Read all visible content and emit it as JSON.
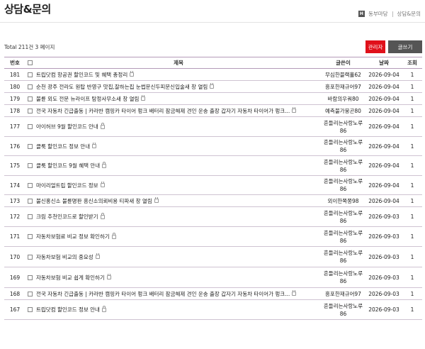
{
  "page": {
    "title": "상담&문의",
    "breadcrumb": {
      "home_glyph": "H",
      "section": "동부마당",
      "current": "상담&문의"
    }
  },
  "toolbar": {
    "total": "Total 211건 3 페이지",
    "admin_label": "관리자",
    "write_label": "글쓰기"
  },
  "table": {
    "headers": {
      "num": "번호",
      "subject": "제목",
      "writer": "글쓴이",
      "date": "날짜",
      "views": "조회"
    },
    "rows": [
      {
        "num": "181",
        "subject": "트립닷컴 항공권 할인코드 및 혜택 총정리",
        "writer": "무심한블랙홀62",
        "date": "2026-09-04",
        "views": "1",
        "h": 17
      },
      {
        "num": "180",
        "subject": "순천 광주 전라도 원탑 반영구 맛집,잘하는집 눈썹문신두피문신입술새 창 열림",
        "writer": "흥포한재규어97",
        "date": "2026-09-04",
        "views": "1",
        "h": 17
      },
      {
        "num": "179",
        "subject": "불륜 외도 전문 뉴라이프 탐정사무소새 창 열림",
        "writer": "바람의우쿼80",
        "date": "2026-09-04",
        "views": "1",
        "h": 17
      },
      {
        "num": "178",
        "subject": "전국 자동차 긴급출동 | 카라반 캠핑카 타이어 펑크 배터리 잠금해제 견인 운송 출장 갑자기 자동차 타이어가 펑크...",
        "writer": "예측불가뭉곤80",
        "date": "2026-09-04",
        "views": "1",
        "h": 17
      },
      {
        "num": "177",
        "subject": "아이허브 9월 할인코드 안내",
        "writer": "흔들리는사랑노루86",
        "date": "2026-09-04",
        "views": "1",
        "h": 28
      },
      {
        "num": "176",
        "subject": "클룩 할인코드 정보 안내",
        "writer": "흔들리는사랑노루86",
        "date": "2026-09-04",
        "views": "1",
        "h": 27
      },
      {
        "num": "175",
        "subject": "클룩 할인코드 9월 혜택 안내",
        "writer": "흔들리는사랑노루86",
        "date": "2026-09-04",
        "views": "1",
        "h": 28
      },
      {
        "num": "174",
        "subject": "마이리얼트립 할인코드 정보",
        "writer": "흔들리는사랑노루86",
        "date": "2026-09-04",
        "views": "1",
        "h": 27
      },
      {
        "num": "173",
        "subject": "불신홍신소 불륜명판 흥신소의뢰비용 티파새 창 열림",
        "writer": "외이한쪽쫑98",
        "date": "2026-09-04",
        "views": "1",
        "h": 17
      },
      {
        "num": "172",
        "subject": "크림 추천인코드로 할인받기",
        "writer": "흔들리는사랑노루86",
        "date": "2026-09-03",
        "views": "1",
        "h": 28
      },
      {
        "num": "171",
        "subject": "자동차보험료 비교 정보 확인하기",
        "writer": "흔들리는사랑노루86",
        "date": "2026-09-03",
        "views": "1",
        "h": 28
      },
      {
        "num": "170",
        "subject": "자동차보험 비교의 중요성",
        "writer": "흔들리는사랑노루86",
        "date": "2026-09-03",
        "views": "1",
        "h": 29
      },
      {
        "num": "169",
        "subject": "자동차보험 비교 쉽게 확인하기",
        "writer": "흔들리는사랑노루86",
        "date": "2026-09-03",
        "views": "1",
        "h": 29
      },
      {
        "num": "168",
        "subject": "전국 자동차 긴급출동 | 카라반 캠핑카 타이어 펑크 배터리 잠금해제 견인 운송 출장 갑자기 자동차 타이어가 펑크...",
        "writer": "흥포한재규어97",
        "date": "2026-09-03",
        "views": "1",
        "h": 17
      },
      {
        "num": "167",
        "subject": "트립닷컴 할인코드 정보 안내",
        "writer": "흔들리는사랑노루86",
        "date": "2026-09-03",
        "views": "1",
        "h": 28
      }
    ]
  },
  "colors": {
    "accent_red": "#e0101a",
    "row_border": "#cfc3d2",
    "head_border": "#b49ab8"
  }
}
